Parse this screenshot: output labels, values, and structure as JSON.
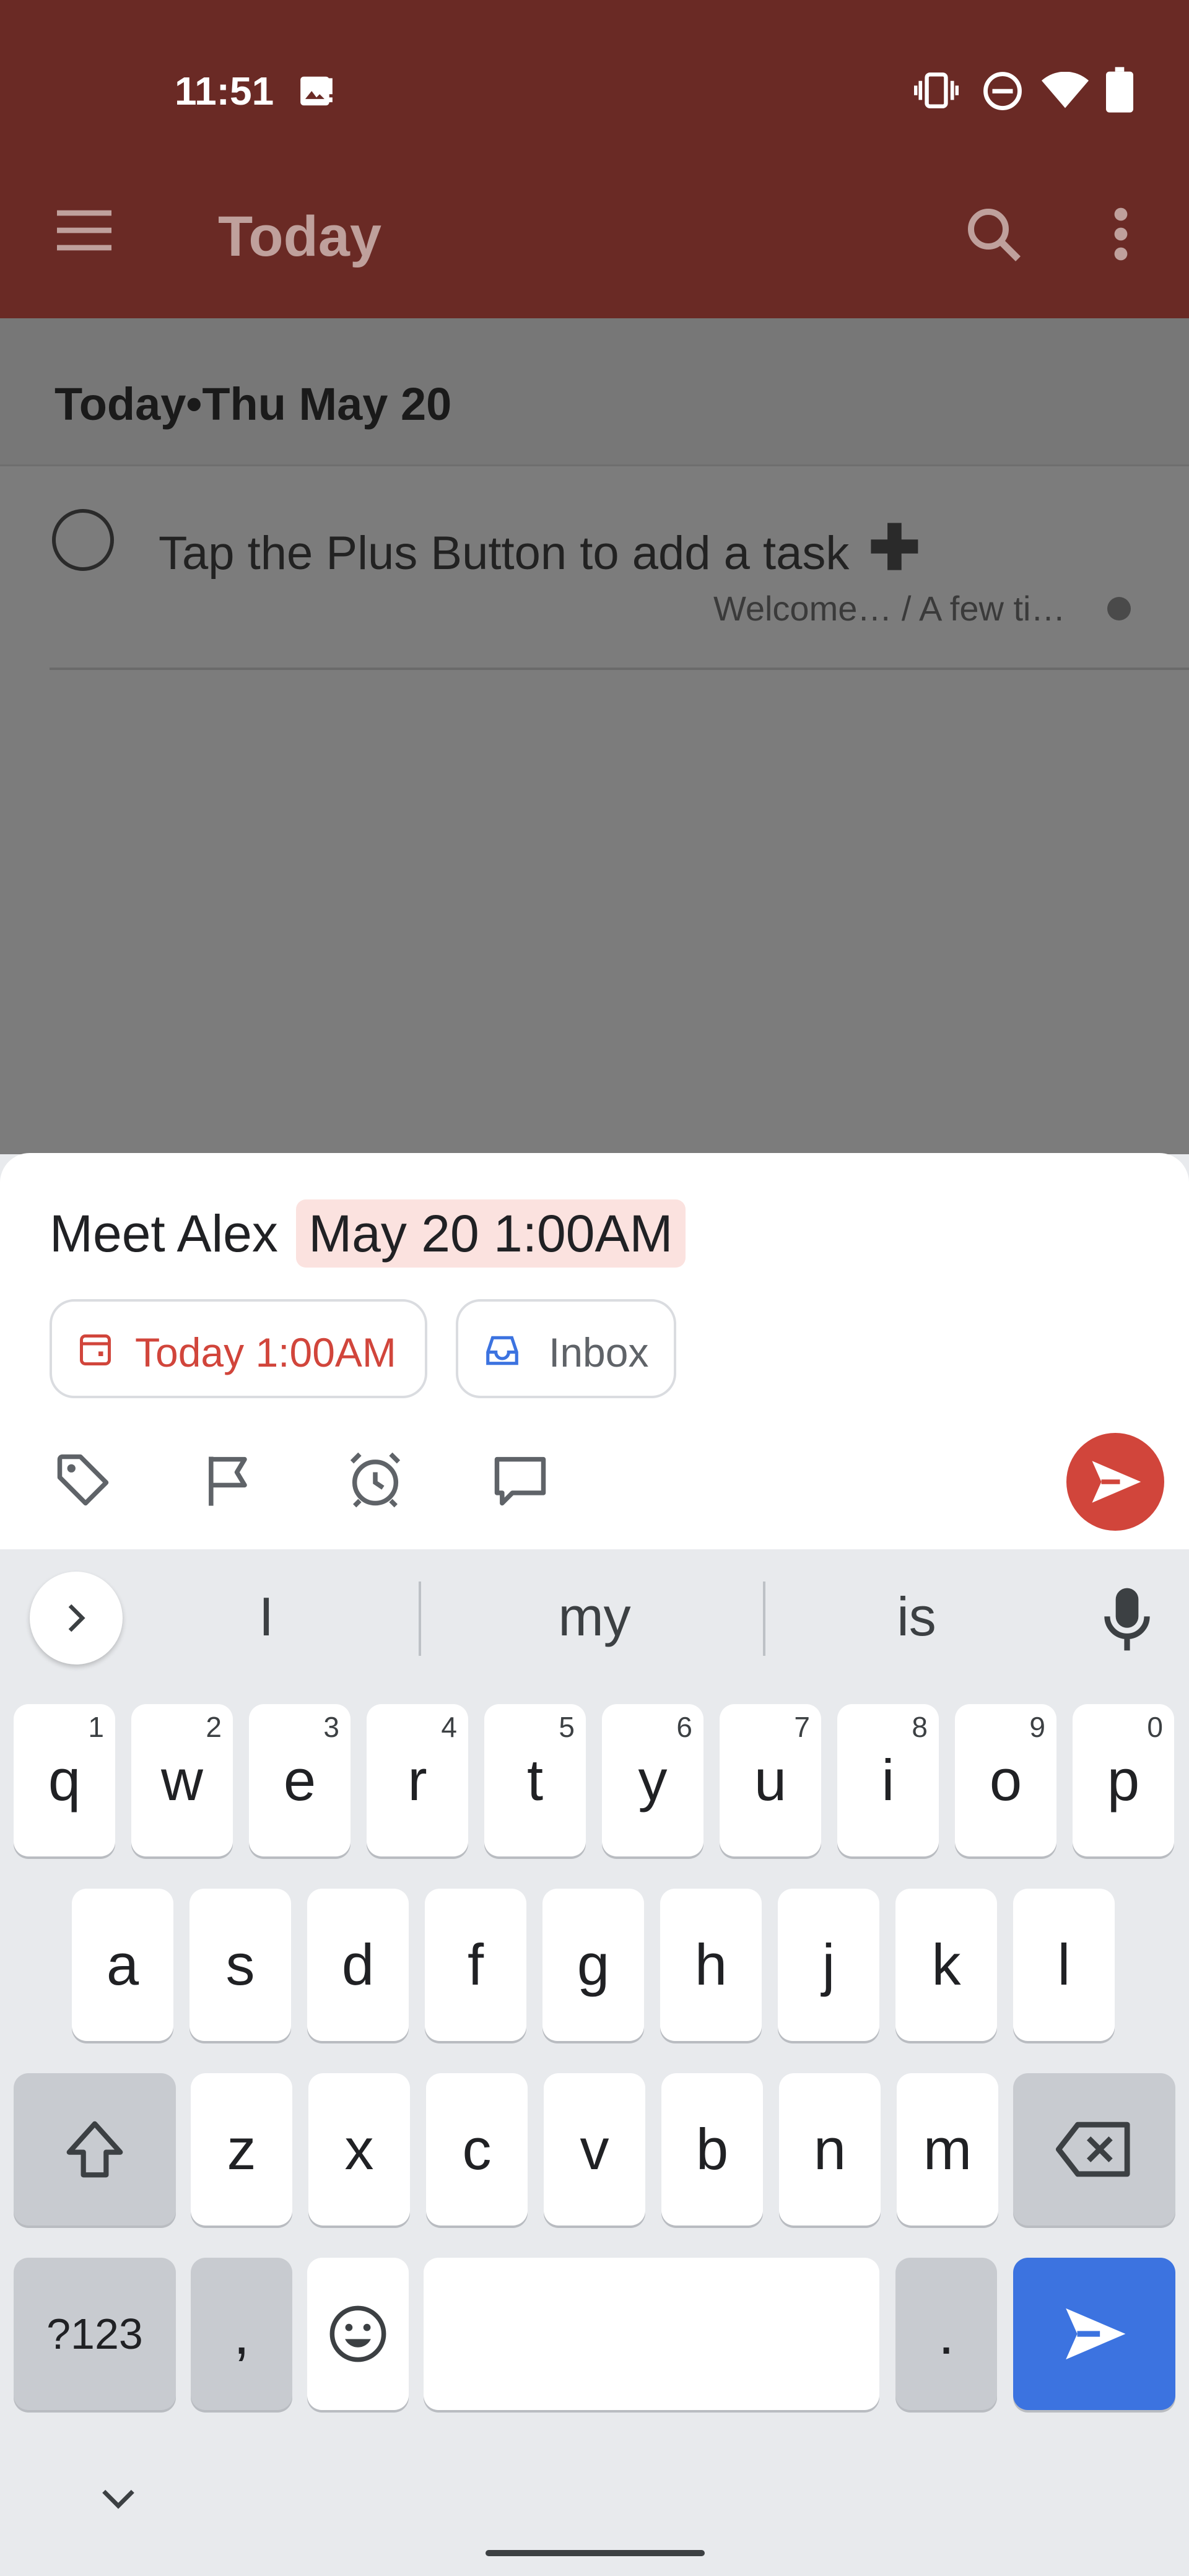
{
  "status_bar": {
    "time": "11:51"
  },
  "app_bar": {
    "title": "Today"
  },
  "section": {
    "header": "Today•Thu May 20"
  },
  "task": {
    "title": "Tap the Plus Button to add a task",
    "plus": "✚",
    "subtitle": "Welcome… / A few ti…"
  },
  "quick_add": {
    "text": "Meet Alex",
    "highlight": "May 20 1:00AM",
    "date_chip": "Today 1:00AM",
    "project_chip": "Inbox",
    "accent_color": "#d1453b"
  },
  "keyboard": {
    "suggestions": [
      "I",
      "my",
      "is"
    ],
    "row1": [
      [
        "q",
        "1"
      ],
      [
        "w",
        "2"
      ],
      [
        "e",
        "3"
      ],
      [
        "r",
        "4"
      ],
      [
        "t",
        "5"
      ],
      [
        "y",
        "6"
      ],
      [
        "u",
        "7"
      ],
      [
        "i",
        "8"
      ],
      [
        "o",
        "9"
      ],
      [
        "p",
        "0"
      ]
    ],
    "row2": [
      "a",
      "s",
      "d",
      "f",
      "g",
      "h",
      "j",
      "k",
      "l"
    ],
    "row3": [
      "z",
      "x",
      "c",
      "v",
      "b",
      "n",
      "m"
    ],
    "symbols": "?123",
    "comma": ",",
    "period": "."
  }
}
